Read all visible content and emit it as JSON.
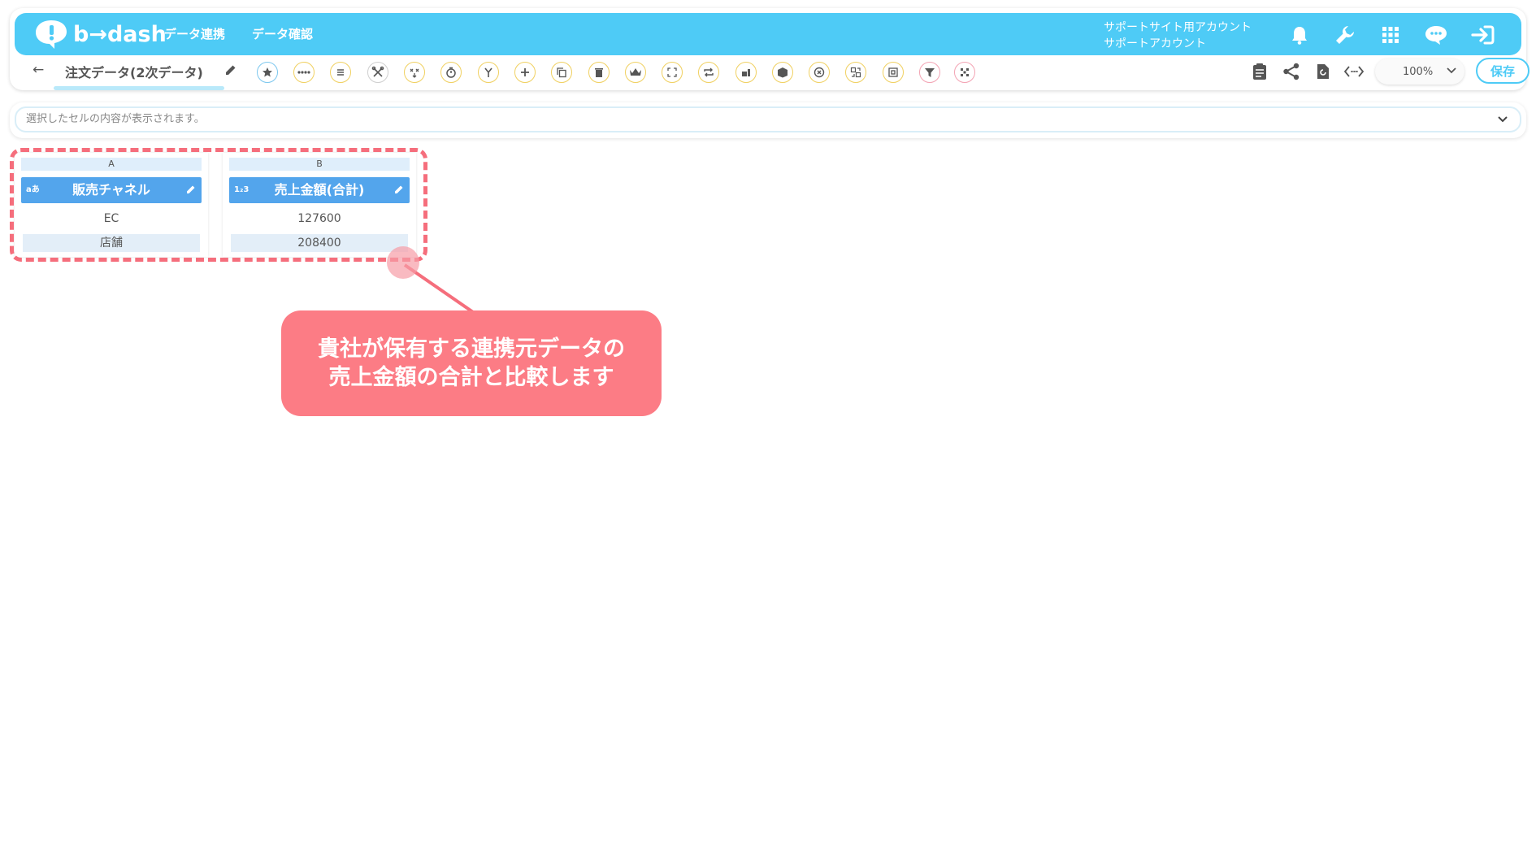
{
  "app": {
    "logo_text": "b→dash",
    "menu": [
      "データ連携",
      "データ確認"
    ],
    "account_line1": "サポートサイト用アカウント",
    "account_line2": "サポートアカウント"
  },
  "sheet": {
    "back": "←",
    "title": "注文データ(2次データ)",
    "zoom": "100%",
    "save_label": "保存"
  },
  "formula_bar": {
    "placeholder": "選択したセルの内容が表示されます。"
  },
  "columns": [
    {
      "letter": "A",
      "type_icon": "aあ",
      "name": "販売チャネル",
      "cells": [
        "EC",
        "店舗"
      ]
    },
    {
      "letter": "B",
      "type_icon": "1₂3",
      "name": "売上金額(合計)",
      "cells": [
        "127600",
        "208400"
      ]
    }
  ],
  "callout": {
    "line1": "貴社が保有する連携元データの",
    "line2": "売上金額の合計と比較します"
  },
  "colors": {
    "brand": "#4ecbf6",
    "column_header": "#53a5ec",
    "annotation": "#fc7c85",
    "dashed_highlight": "#f56e7c"
  },
  "icons": {
    "nav": [
      "bell-icon",
      "wrench-icon",
      "apps-grid-icon",
      "chat-icon",
      "logout-icon"
    ],
    "right_tools": [
      "clipboard-icon",
      "share-icon",
      "refresh-icon",
      "code-icon"
    ]
  }
}
